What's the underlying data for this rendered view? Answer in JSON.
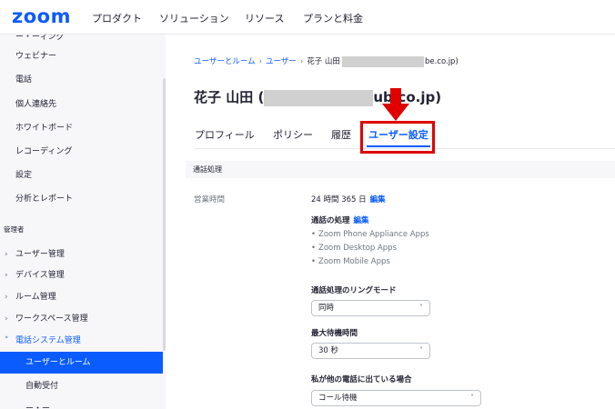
{
  "brand": {
    "logo_text": "zoom",
    "color": "#0b5cff"
  },
  "topnav": {
    "links": [
      "プロダクト",
      "ソリューション",
      "リソース",
      "プランと料金"
    ]
  },
  "sidebar": {
    "top_items": [
      "ウェビナー",
      "電話",
      "個人連絡先",
      "ホワイトボード",
      "レコーディング",
      "設定",
      "分析とレポート"
    ],
    "admin_section": "管理者",
    "admin_items": [
      "ユーザー管理",
      "デバイス管理",
      "ルーム管理",
      "ワークスペース管理"
    ],
    "phone_system": "電話システム管理",
    "phone_sub": [
      "ユーザーとルーム",
      "自動受付"
    ]
  },
  "breadcrumb": {
    "items": [
      "ユーザーとルーム",
      "ユーザー"
    ],
    "current_prefix": "花子 山田",
    "current_suffix": "be.co.jp)"
  },
  "page_title": {
    "prefix": "花子 山田 (",
    "suffix": "ub.co.jp)"
  },
  "tabs": [
    "プロフィール",
    "ポリシー",
    "履歴",
    "ユーザー設定"
  ],
  "section": {
    "label": "通話処理"
  },
  "business_hours": {
    "label": "営業時間",
    "value": "24 時間 365 日",
    "edit": "編集"
  },
  "call_handling": {
    "title": "通話の処理",
    "edit": "編集",
    "apps": [
      "Zoom Phone Appliance Apps",
      "Zoom Desktop Apps",
      "Zoom Mobile Apps"
    ]
  },
  "ring_mode": {
    "label": "通話処理のリングモード",
    "value": "同時"
  },
  "max_wait": {
    "label": "最大待機時間",
    "value": "30 秒"
  },
  "busy": {
    "label": "私が他の電話に出ている場合",
    "value": "コール待機"
  }
}
